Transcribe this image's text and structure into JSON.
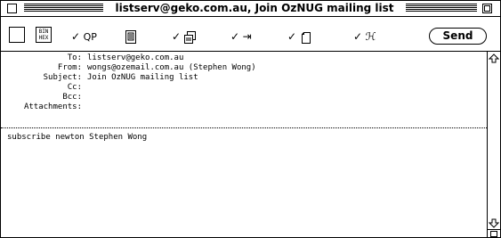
{
  "window": {
    "title": "listserv@geko.com.au, Join OzNUG mailing list"
  },
  "toolbar": {
    "binhex_label": "BIN\nHEX",
    "qp_label": "QP",
    "send_label": "Send"
  },
  "headers": [
    {
      "label": "To:",
      "value": "listserv@geko.com.au"
    },
    {
      "label": "From:",
      "value": "wongs@ozemail.com.au (Stephen Wong)"
    },
    {
      "label": "Subject:",
      "value": "Join OzNUG mailing list"
    },
    {
      "label": "Cc:",
      "value": ""
    },
    {
      "label": "Bcc:",
      "value": ""
    },
    {
      "label": "Attachments:",
      "value": ""
    }
  ],
  "body": {
    "text": "subscribe newton Stephen Wong"
  },
  "icons": {
    "close": "close-box-icon",
    "zoom": "zoom-box-icon",
    "signature": "signature-icon",
    "attach": "attach-document-icon",
    "tab": "tab-arrow-icon",
    "copy": "copy-to-self-icon",
    "wrap": "word-wrap-icon"
  }
}
